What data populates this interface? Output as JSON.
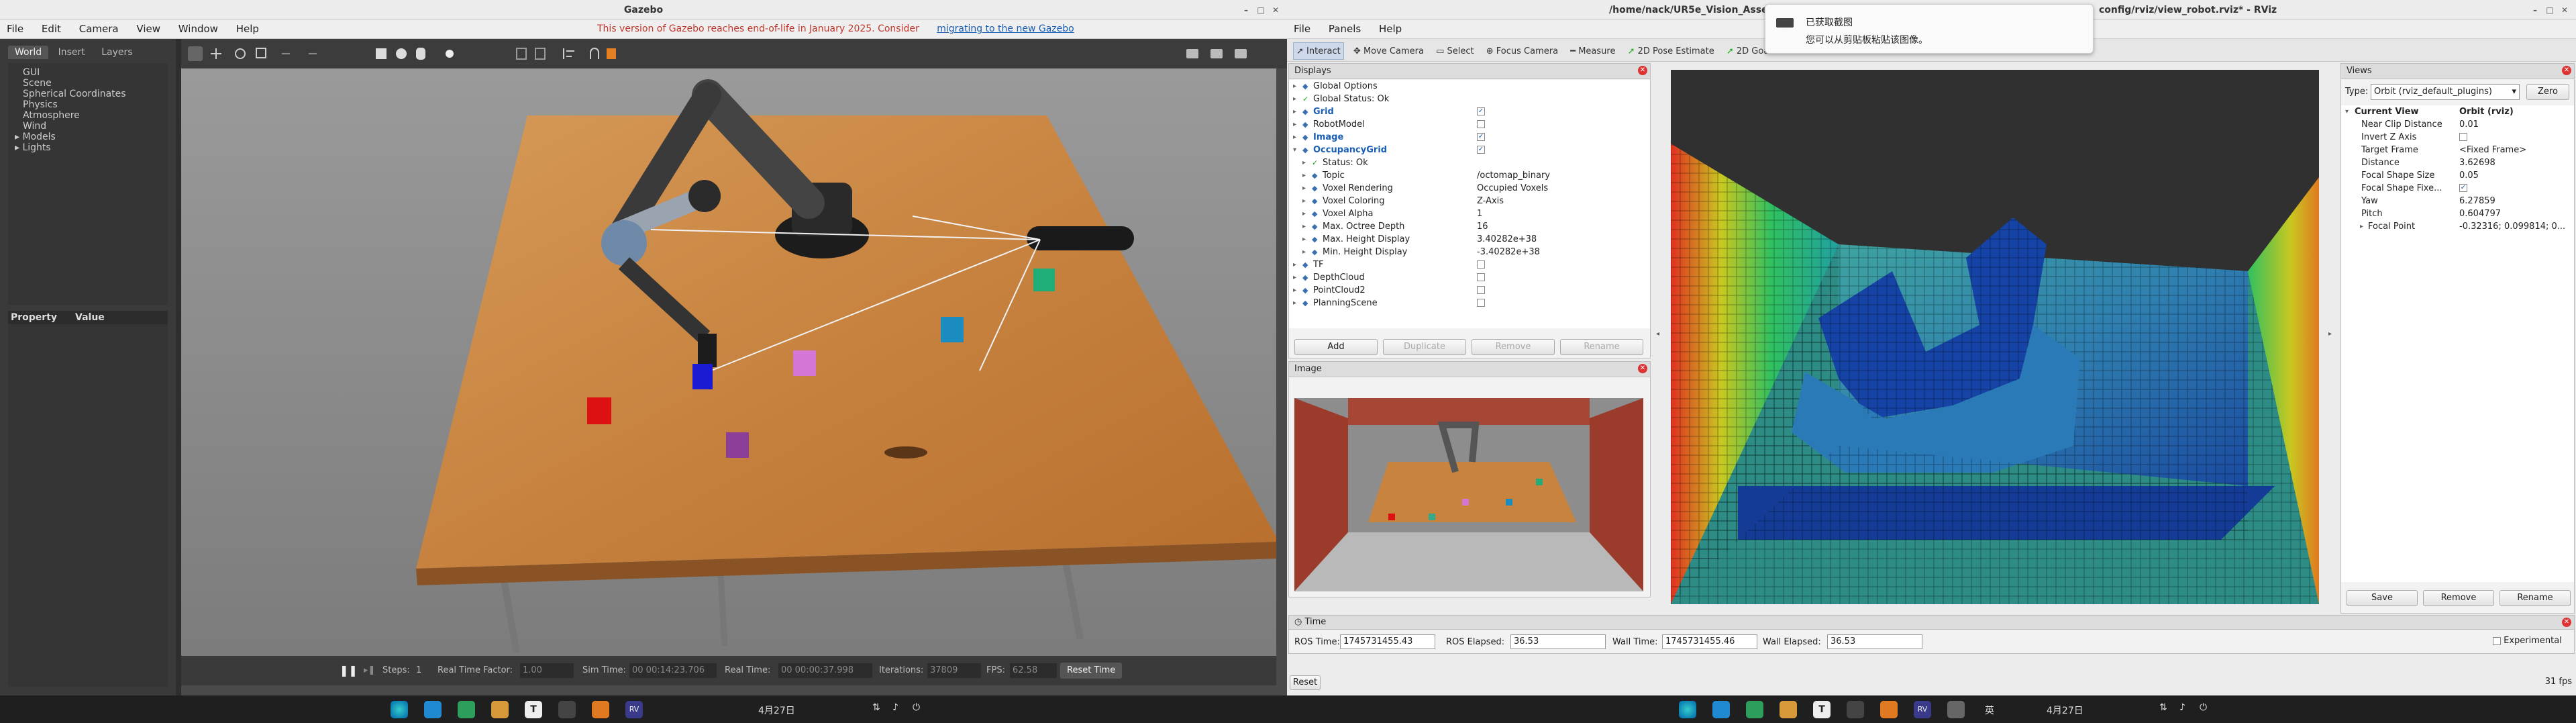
{
  "gazebo": {
    "title": "Gazebo",
    "menu": [
      "File",
      "Edit",
      "Camera",
      "View",
      "Window",
      "Help"
    ],
    "notice": "This version of Gazebo reaches end-of-life in January 2025. Consider ",
    "notice_link": "migrating to the new Gazebo",
    "side_tabs": [
      "World",
      "Insert",
      "Layers"
    ],
    "tree": [
      "GUI",
      "Scene",
      "Spherical Coordinates",
      "Physics",
      "Atmosphere",
      "Wind",
      "Models",
      "Lights"
    ],
    "prop_header": [
      "Property",
      "Value"
    ],
    "bottom": {
      "steps_label": "Steps:",
      "steps_value": "1",
      "rtf_label": "Real Time Factor:",
      "rtf_value": "1.00",
      "sim_label": "Sim Time:",
      "sim_value": "00 00:14:23.706",
      "real_label": "Real Time:",
      "real_value": "00 00:00:37.998",
      "iter_label": "Iterations:",
      "iter_value": "37809",
      "fps_label": "FPS:",
      "fps_value": "62.58",
      "reset": "Reset Time"
    }
  },
  "rviz": {
    "title": "/home/nack/UR5e_Vision_Assem...config/rviz/view_robot.rviz* - RViz",
    "title_left": "/home/nack/UR5e_Vision_Assem",
    "title_right": "config/rviz/view_robot.rviz* - RViz",
    "menu": [
      "File",
      "Panels",
      "Help"
    ],
    "tools": [
      "Interact",
      "Move Camera",
      "Select",
      "Focus Camera",
      "Measure",
      "2D Pose Estimate",
      "2D Goal"
    ],
    "displays_title": "Displays",
    "displays": [
      {
        "label": "Global Options",
        "value": "",
        "cb": ""
      },
      {
        "label": "Global Status: Ok",
        "value": "",
        "cb": ""
      },
      {
        "label": "Grid",
        "value": "",
        "cb": "✓"
      },
      {
        "label": "RobotModel",
        "value": "",
        "cb": " "
      },
      {
        "label": "Image",
        "value": "",
        "cb": "✓"
      },
      {
        "label": "OccupancyGrid",
        "value": "",
        "cb": "✓"
      },
      {
        "label": "Status: Ok",
        "value": "",
        "cb": ""
      },
      {
        "label": "Topic",
        "value": "/octomap_binary",
        "cb": ""
      },
      {
        "label": "Voxel Rendering",
        "value": "Occupied Voxels",
        "cb": ""
      },
      {
        "label": "Voxel Coloring",
        "value": "Z-Axis",
        "cb": ""
      },
      {
        "label": "Voxel Alpha",
        "value": "1",
        "cb": ""
      },
      {
        "label": "Max. Octree Depth",
        "value": "16",
        "cb": ""
      },
      {
        "label": "Max. Height Display",
        "value": "3.40282e+38",
        "cb": ""
      },
      {
        "label": "Min. Height Display",
        "value": "-3.40282e+38",
        "cb": ""
      },
      {
        "label": "TF",
        "value": "",
        "cb": " "
      },
      {
        "label": "DepthCloud",
        "value": "",
        "cb": " "
      },
      {
        "label": "PointCloud2",
        "value": "",
        "cb": " "
      },
      {
        "label": "PlanningScene",
        "value": "",
        "cb": " "
      }
    ],
    "display_buttons": [
      "Add",
      "Duplicate",
      "Remove",
      "Rename"
    ],
    "image_title": "Image",
    "views_title": "Views",
    "views_type_label": "Type:",
    "views_type_value": "Orbit (rviz_default_plugins)",
    "views_zero": "Zero",
    "views_rows": [
      {
        "label": "Current View",
        "value": "Orbit (rviz)"
      },
      {
        "label": "Near Clip Distance",
        "value": "0.01"
      },
      {
        "label": "Invert Z Axis",
        "value": ""
      },
      {
        "label": "Target Frame",
        "value": "<Fixed Frame>"
      },
      {
        "label": "Distance",
        "value": "3.62698"
      },
      {
        "label": "Focal Shape Size",
        "value": "0.05"
      },
      {
        "label": "Focal Shape Fixe...",
        "value": ""
      },
      {
        "label": "Yaw",
        "value": "6.27859"
      },
      {
        "label": "Pitch",
        "value": "0.604797"
      },
      {
        "label": "Focal Point",
        "value": "-0.32316; 0.099814; 0..."
      }
    ],
    "views_buttons": [
      "Save",
      "Remove",
      "Rename"
    ],
    "time_title": "Time",
    "ros_time_label": "ROS Time:",
    "ros_time": "1745731455.43",
    "ros_elapsed_label": "ROS Elapsed:",
    "ros_elapsed": "36.53",
    "wall_time_label": "Wall Time:",
    "wall_time": "1745731455.46",
    "wall_elapsed_label": "Wall Elapsed:",
    "wall_elapsed": "36.53",
    "experimental": "Experimental",
    "reset": "Reset",
    "fps": "31 fps"
  },
  "notification": {
    "title": "已获取截图",
    "body": "您可以从剪贴板粘贴该图像。"
  },
  "taskbar": {
    "date_left": "4月27日",
    "date_right": "4月27日",
    "ime": "英"
  }
}
